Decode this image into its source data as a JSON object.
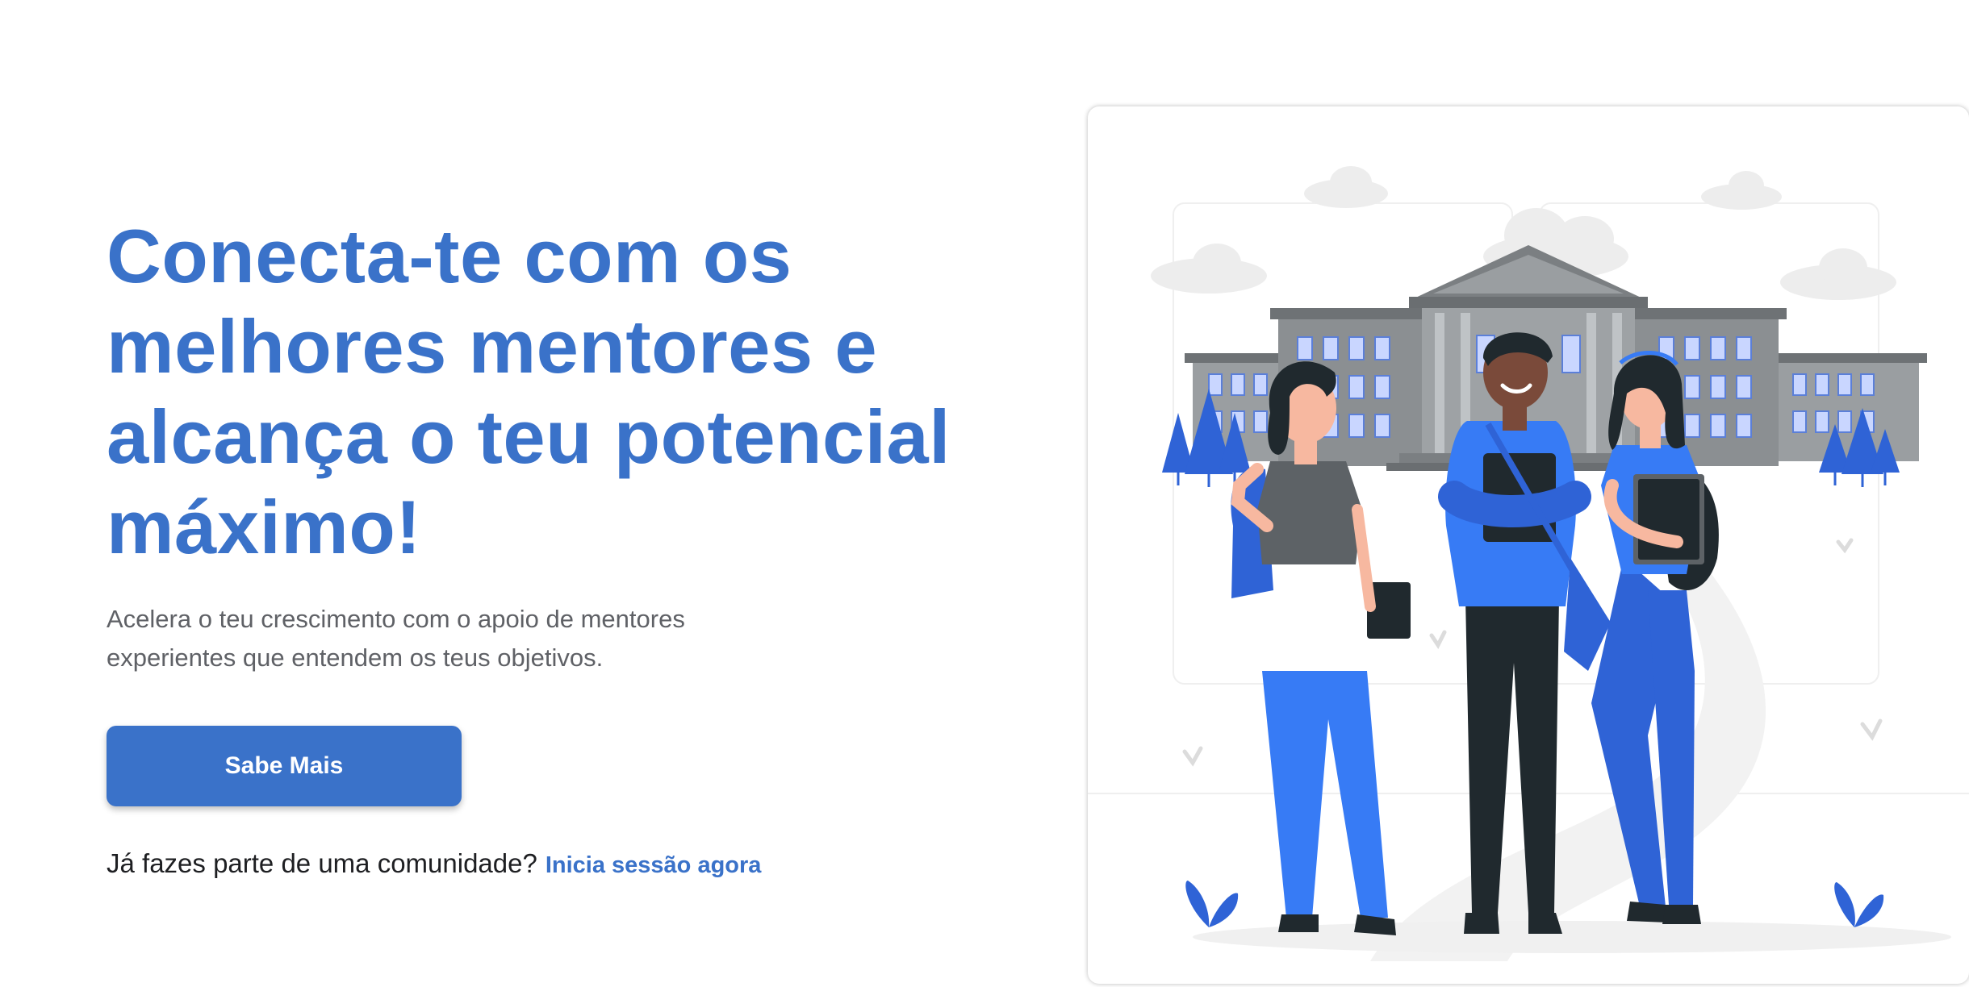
{
  "hero": {
    "headline_lines": [
      "Conecta-te com os",
      "melhores mentores e",
      "alcança o teu potencial",
      "máximo!"
    ],
    "subtitle_lines": [
      "Acelera o teu crescimento com o apoio de mentores",
      "experientes que entendem os teus objetivos."
    ]
  },
  "cta": {
    "label": "Sabe Mais"
  },
  "login": {
    "prompt": "Já fazes parte de uma comunidade?",
    "link_label": "Inicia sessão agora"
  },
  "illustration": {
    "subject": "students-in-front-of-university-illustration"
  },
  "colors": {
    "primary": "#3a72c9",
    "subtitle_text": "#5f6166",
    "body_text": "#1e1f22",
    "illustration_blue": "#377bf5",
    "illustration_dark": "#20292e",
    "building_gray": "#8b8f92"
  }
}
